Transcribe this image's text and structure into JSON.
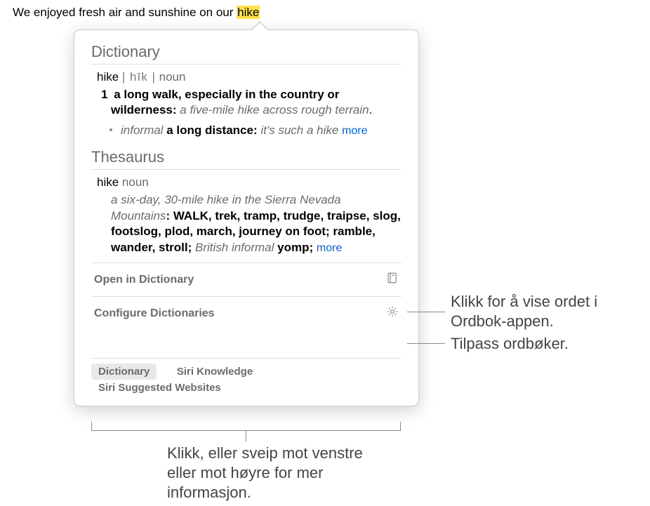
{
  "sentence": {
    "prefix": "We enjoyed fresh air and sunshine on our ",
    "word": "hike"
  },
  "dictionary": {
    "title": "Dictionary",
    "headword": "hike",
    "pronunciation": "| hīk |",
    "pos": "noun",
    "sense_num": "1",
    "definition": "a long walk, especially in the country or wilderness:",
    "example": "a five-mile hike across rough terrain",
    "sub_register": "informal",
    "sub_definition": "a long distance:",
    "sub_example": "it's such a hike",
    "more": "more"
  },
  "thesaurus": {
    "title": "Thesaurus",
    "headword": "hike",
    "pos": "noun",
    "example": "a six-day, 30-mile hike in the Sierra Nevada Mountains",
    "lead_syn": "WALK",
    "syns": ", trek, tramp, trudge, traipse, slog, footslog, plod, march, journey on foot; ramble, wander, stroll; ",
    "british": "British informal",
    "british_syn": " yomp; ",
    "more": "more"
  },
  "actions": {
    "open": "Open in Dictionary",
    "configure": "Configure Dictionaries"
  },
  "tabs": {
    "dictionary": "Dictionary",
    "siri_knowledge": "Siri Knowledge",
    "siri_websites": "Siri Suggested Websites"
  },
  "callouts": {
    "open": "Klikk for å vise ordet i Ordbok-appen.",
    "configure": "Tilpass ordbøker.",
    "tabs": "Klikk, eller sveip mot venstre eller mot høyre for mer informasjon."
  }
}
